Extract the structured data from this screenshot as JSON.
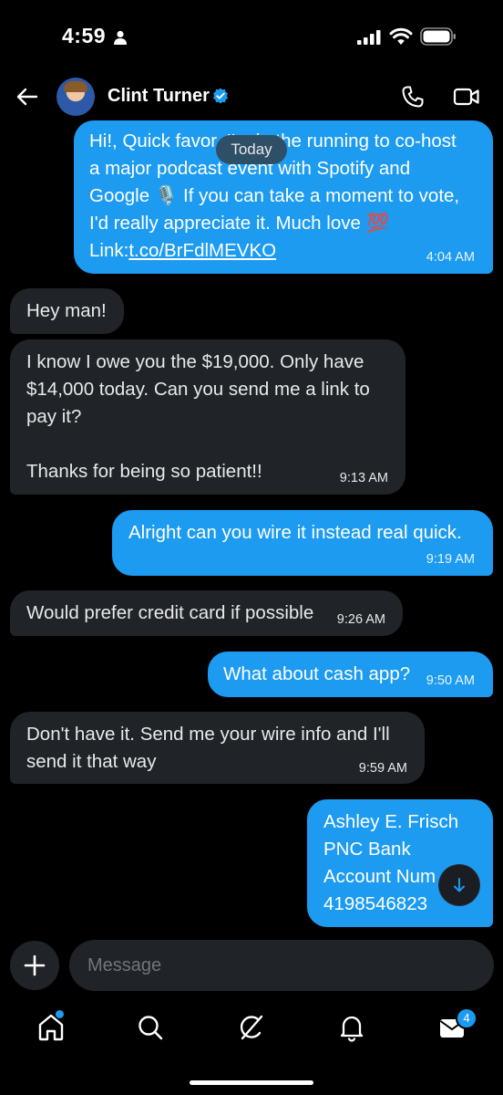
{
  "status_bar": {
    "time": "4:59"
  },
  "header": {
    "contact_name": "Clint Turner"
  },
  "divider": {
    "label": "Today"
  },
  "messages": [
    {
      "direction": "sent",
      "lines": [
        "Hi!, Quick favor, I'm in the running to co-host",
        "a major podcast event with Spotify and",
        "Google 🎙️ If you can take a moment to vote,",
        "I'd really appreciate it. Much love 💯"
      ],
      "link_prefix": "Link:",
      "link_text": "t.co/BrFdlMEVKO",
      "time": "4:04 AM"
    },
    {
      "direction": "received",
      "text": "Hey man!"
    },
    {
      "direction": "received",
      "lines": [
        "I know I owe you the $19,000. Only have",
        "$14,000 today. Can you send me a link to",
        "pay it?",
        "",
        "Thanks for being so patient!!"
      ],
      "time": "9:13 AM"
    },
    {
      "direction": "sent",
      "text": "Alright can you wire it instead real quick.",
      "time": "9:19 AM"
    },
    {
      "direction": "received",
      "text": "Would prefer credit card if possible",
      "time": "9:26 AM"
    },
    {
      "direction": "sent",
      "text": "What about cash app?",
      "time": "9:50 AM"
    },
    {
      "direction": "received",
      "lines": [
        "Don't have it. Send me your wire info and I'll",
        "send it that way"
      ],
      "time": "9:59 AM"
    },
    {
      "direction": "sent",
      "lines": [
        "Ashley E. Frisch",
        "PNC Bank",
        "Account Num",
        "4198546823"
      ]
    }
  ],
  "composer": {
    "placeholder": "Message"
  },
  "tab_bar": {
    "items": [
      {
        "name": "home",
        "icon": "home-icon",
        "has_dot": true
      },
      {
        "name": "search",
        "icon": "search-icon"
      },
      {
        "name": "grok",
        "icon": "grok-icon"
      },
      {
        "name": "notifications",
        "icon": "bell-icon"
      },
      {
        "name": "messages",
        "icon": "mail-icon",
        "badge": "4"
      }
    ]
  },
  "colors": {
    "accent": "#1d9bf0",
    "received_bubble": "#202327",
    "background": "#000000"
  }
}
